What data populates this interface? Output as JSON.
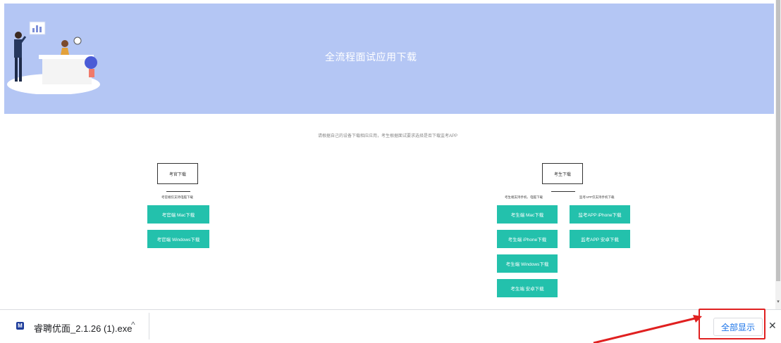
{
  "banner": {
    "title": "全流程面试应用下载"
  },
  "hint": "请根据自己的设备下载相应应用，考生根据面试要求选择是否下载监考APP",
  "interviewer": {
    "title": "考官下载",
    "note": "考官端仅支持电脑下载",
    "buttons": [
      "考官端 Mac下载",
      "考官端 Windows下载"
    ]
  },
  "candidate": {
    "title": "考生下载",
    "note_left": "考生端支持手机、电脑下载",
    "note_right": "监考APP仅支持手机下载",
    "client_buttons": [
      "考生端 Mac下载",
      "考生端 iPhone下载",
      "考生端 Windows下载",
      "考生端 安卓下载"
    ],
    "monitor_buttons": [
      "监考APP iPhone下载",
      "监考APP 安卓下载"
    ]
  },
  "download_bar": {
    "file_name": "睿聘优面_2.1.26 (1).exe",
    "file_icon_label": "M",
    "chevron": "^",
    "show_all": "全部显示",
    "close": "✕"
  },
  "colors": {
    "banner": "#b4c6f4",
    "button": "#23c1ac",
    "highlight": "#e02020"
  }
}
